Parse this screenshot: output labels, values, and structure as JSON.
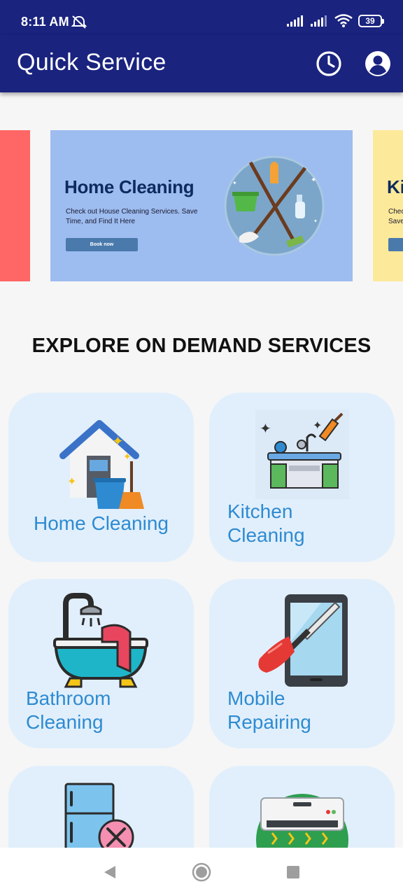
{
  "status_bar": {
    "time": "8:11 AM",
    "battery": "39"
  },
  "app_bar": {
    "title": "Quick Service"
  },
  "carousel": {
    "main_slide": {
      "title": "Home Cleaning",
      "description": "Check out House Cleaning Services. Save Time, and Find It Here",
      "button_label": "Book now"
    },
    "next_slide": {
      "title": "Ki",
      "description_line1": "Chec",
      "description_line2": "Save"
    }
  },
  "section": {
    "heading": "EXPLORE ON DEMAND SERVICES"
  },
  "services": [
    {
      "label": "Home Cleaning",
      "label_line1": "Home Cleaning",
      "label_line2": ""
    },
    {
      "label": "Kitchen Cleaning",
      "label_line1": "Kitchen",
      "label_line2": "Cleaning"
    },
    {
      "label": "Bathroom Cleaning",
      "label_line1": "Bathroom",
      "label_line2": "Cleaning"
    },
    {
      "label": "Mobile Repairing",
      "label_line1": "Mobile",
      "label_line2": "Repairing"
    }
  ],
  "colors": {
    "primary": "#1a237e",
    "card_background": "#e1effc",
    "card_label": "#2e8bd1",
    "banner_main": "#9dbcf0",
    "banner_prev": "#ff6666",
    "banner_next": "#fde99a"
  },
  "icons": {
    "app_bar": [
      "history-icon",
      "account-icon"
    ],
    "nav_bar": [
      "back-icon",
      "home-icon",
      "recents-icon"
    ]
  }
}
